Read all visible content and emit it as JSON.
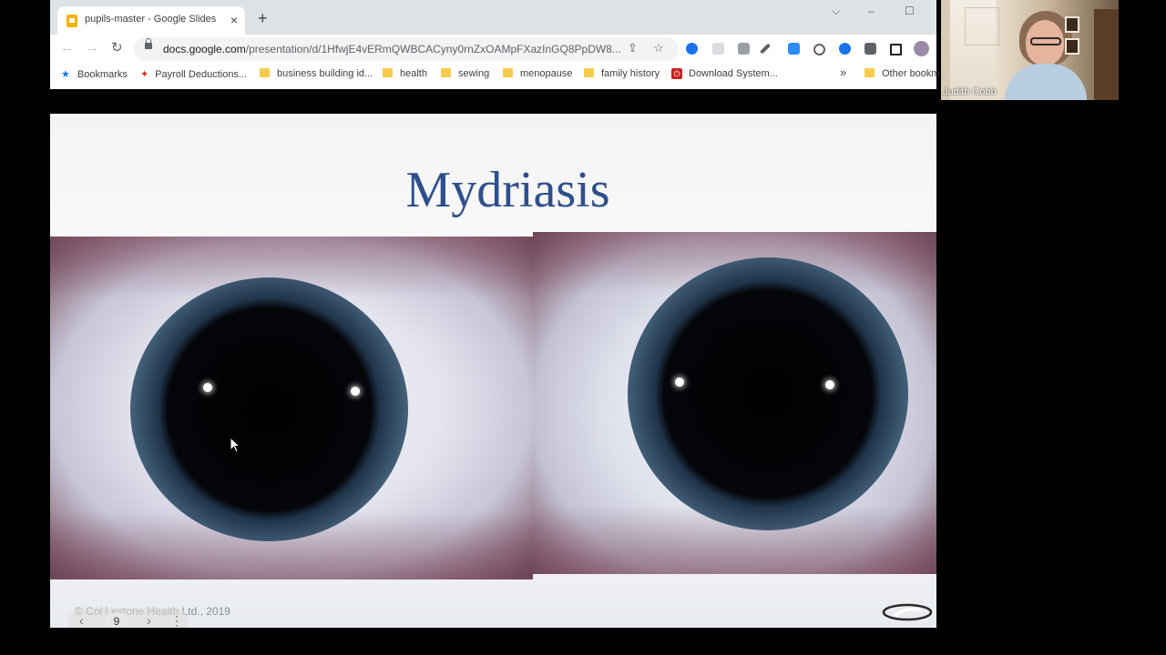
{
  "browser": {
    "tab_title": "pupils-master - Google Slides",
    "tab_close": "×",
    "new_tab": "+",
    "window_controls": {
      "collapse": "⌵",
      "minimize": "–",
      "maximize": "☐"
    },
    "nav": {
      "back": "←",
      "forward": "→",
      "reload": "↻"
    },
    "url_host": "docs.google.com",
    "url_path": "/presentation/d/1HfwjE4vERmQWBCACyny0rnZxOAMpFXazInGQ8PpDW8...",
    "bookmarks": [
      {
        "label": "Bookmarks",
        "icon": "star-icon"
      },
      {
        "label": "Payroll Deductions...",
        "icon": "maple-leaf-icon"
      },
      {
        "label": "business building id...",
        "icon": "folder-icon"
      },
      {
        "label": "health",
        "icon": "folder-icon"
      },
      {
        "label": "sewing",
        "icon": "folder-icon"
      },
      {
        "label": "menopause",
        "icon": "folder-icon"
      },
      {
        "label": "family history",
        "icon": "folder-icon"
      },
      {
        "label": "Download System...",
        "icon": "power-icon"
      }
    ],
    "bookmarks_overflow": "»",
    "other_bookmarks": "Other bookm"
  },
  "slide": {
    "title": "Mydriasis",
    "footer": "© Col  Lestone Health Ltd., 2019",
    "number": "9",
    "prev": "‹",
    "next": "›",
    "more": "⋮"
  },
  "webcam": {
    "name": "Judith Cobb"
  },
  "colors": {
    "title": "#2e4f8c",
    "chrome_tabstrip": "#dee1e6",
    "folder": "#f7cb4d"
  }
}
